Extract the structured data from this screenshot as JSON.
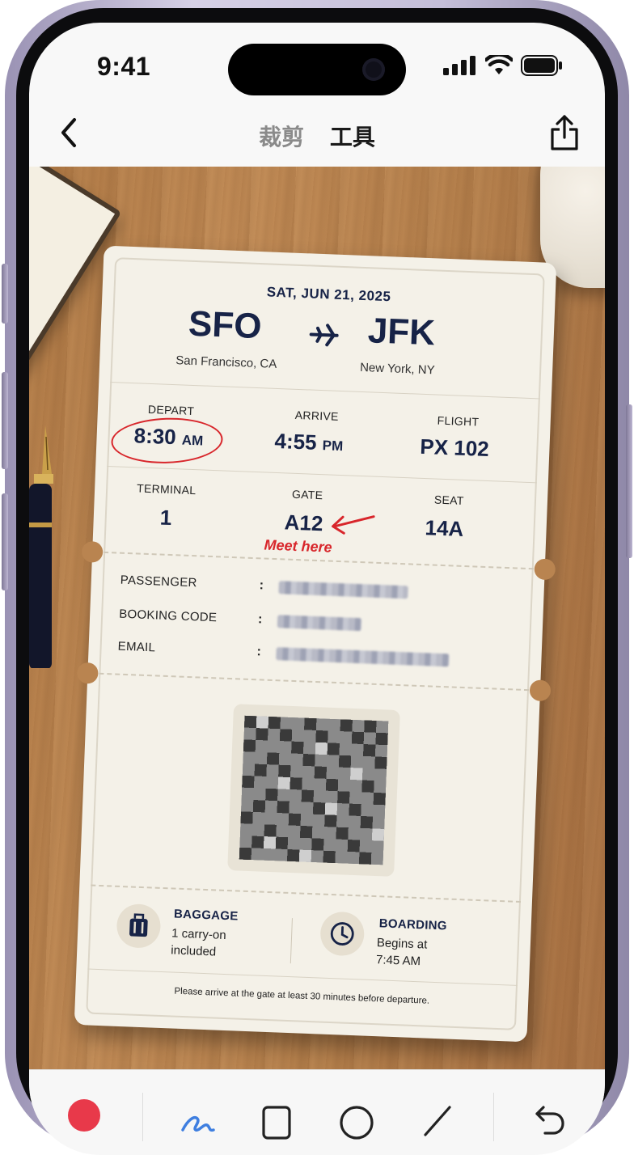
{
  "status_bar": {
    "time": "9:41"
  },
  "nav": {
    "crop_tab": "裁剪",
    "tools_tab": "工具"
  },
  "ticket": {
    "date": "SAT, JUN 21, 2025",
    "origin_code": "SFO",
    "origin_city": "San Francisco, CA",
    "destination_code": "JFK",
    "destination_city": "New York, NY",
    "depart_label": "DEPART",
    "depart_time": "8:30",
    "depart_ampm": "AM",
    "arrive_label": "ARRIVE",
    "arrive_time": "4:55",
    "arrive_ampm": "PM",
    "flight_label": "FLIGHT",
    "flight_value": "PX 102",
    "terminal_label": "TERMINAL",
    "terminal_value": "1",
    "gate_label": "GATE",
    "gate_value": "A12",
    "seat_label": "SEAT",
    "seat_value": "14A",
    "passenger_label": "PASSENGER",
    "booking_label": "BOOKING CODE",
    "email_label": "EMAIL",
    "colon": ":",
    "baggage_title": "BAGGAGE",
    "baggage_line1": "1 carry-on",
    "baggage_line2": "included",
    "boarding_title": "BOARDING",
    "boarding_line1": "Begins at",
    "boarding_line2": "7:45 AM",
    "footnote": "Please arrive at the gate at least 30 minutes before departure."
  },
  "annotations": {
    "meet_note": "Meet here",
    "markup_color": "#d8262b"
  },
  "toolbar": {
    "selected_tool": "pen",
    "color_swatch": "#e8394a",
    "pen_color": "#3f7fe0"
  }
}
